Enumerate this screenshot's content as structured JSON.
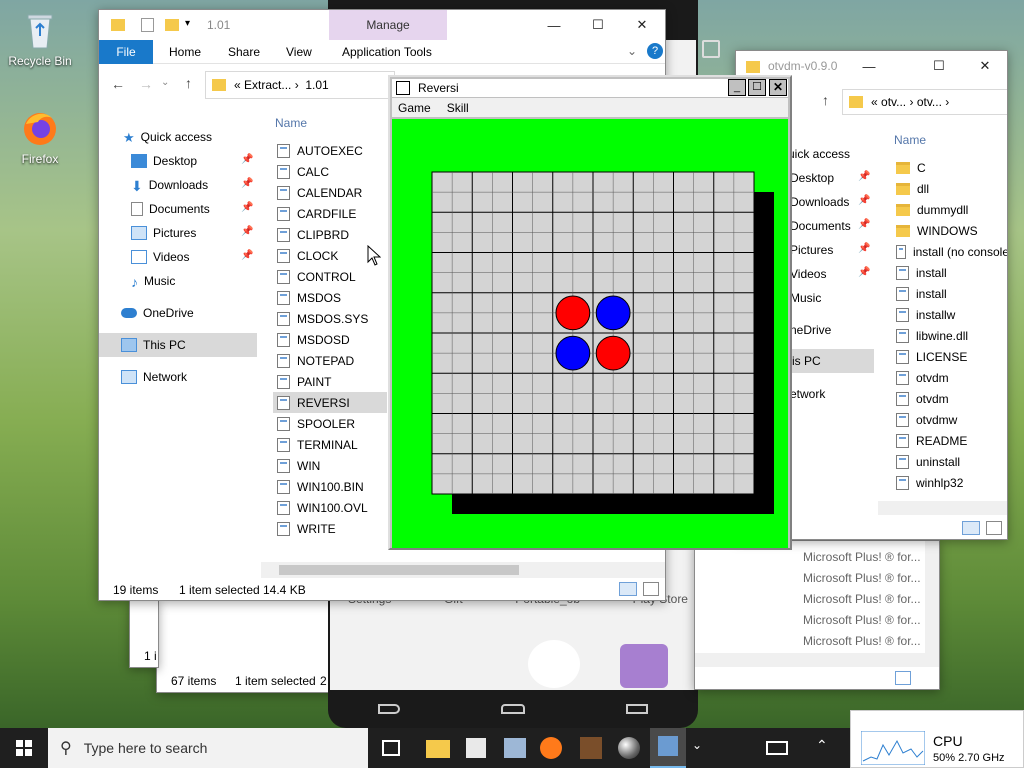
{
  "desktop": {
    "recycle_bin": "Recycle Bin",
    "firefox": "Firefox"
  },
  "explorer_back": {
    "status_items": "67 items",
    "status_selected": "1 item selected",
    "status_cut": "2"
  },
  "phone": {
    "labels": [
      "Settings",
      "Gift",
      "Portable_ob",
      "Play Store"
    ]
  },
  "otvdm": {
    "title": "otvdm-v0.9.0",
    "breadcrumb": [
      "otv...",
      "otv..."
    ],
    "column_name": "Name",
    "nav": [
      "uick access",
      "Desktop",
      "Downloads",
      "Documents",
      "Pictures",
      "Videos",
      "Music",
      "neDrive",
      "is PC",
      "etwork"
    ],
    "files": [
      {
        "name": "C",
        "kind": "folder"
      },
      {
        "name": "dll",
        "kind": "folder"
      },
      {
        "name": "dummydll",
        "kind": "folder"
      },
      {
        "name": "WINDOWS",
        "kind": "folder"
      },
      {
        "name": "install (no console",
        "kind": "file"
      },
      {
        "name": "install",
        "kind": "file"
      },
      {
        "name": "install",
        "kind": "file"
      },
      {
        "name": "installw",
        "kind": "file"
      },
      {
        "name": "libwine.dll",
        "kind": "file"
      },
      {
        "name": "LICENSE",
        "kind": "file"
      },
      {
        "name": "otvdm",
        "kind": "file"
      },
      {
        "name": "otvdm",
        "kind": "file"
      },
      {
        "name": "otvdmw",
        "kind": "file"
      },
      {
        "name": "README",
        "kind": "file"
      },
      {
        "name": "uninstall",
        "kind": "file"
      },
      {
        "name": "winhlp32",
        "kind": "file"
      }
    ]
  },
  "midlist": {
    "rows": [
      "Microsoft Plus! ® for...",
      "Microsoft Plus! ® for...",
      "Microsoft Plus! ® for...",
      "Microsoft Plus! ® for...",
      "Microsoft Plus! ® for..."
    ]
  },
  "explorer": {
    "title": "1.01",
    "manage_tab": "Manage",
    "tabs": [
      "File",
      "Home",
      "Share",
      "View",
      "Application Tools"
    ],
    "breadcrumb": [
      "Extract...",
      "1.01"
    ],
    "quick_access": "Quick access",
    "nav": [
      "Desktop",
      "Downloads",
      "Documents",
      "Pictures",
      "Videos",
      "Music"
    ],
    "onedrive": "OneDrive",
    "this_pc": "This PC",
    "network": "Network",
    "column_name": "Name",
    "files": [
      "AUTOEXEC",
      "CALC",
      "CALENDAR",
      "CARDFILE",
      "CLIPBRD",
      "CLOCK",
      "CONTROL",
      "MSDOS",
      "MSDOS.SYS",
      "MSDOSD",
      "NOTEPAD",
      "PAINT",
      "REVERSI",
      "SPOOLER",
      "TERMINAL",
      "WIN",
      "WIN100.BIN",
      "WIN100.OVL",
      "WRITE"
    ],
    "selected_file": "REVERSI",
    "status_items": "19 items",
    "status_selected": "1 item selected",
    "status_size": "14.4 KB"
  },
  "reversi": {
    "title": "Reversi",
    "menu": [
      "Game",
      "Skill"
    ],
    "board_size": 8,
    "pieces": [
      {
        "row": 3,
        "col": 3,
        "color": "red"
      },
      {
        "row": 3,
        "col": 4,
        "color": "blue"
      },
      {
        "row": 4,
        "col": 3,
        "color": "blue"
      },
      {
        "row": 4,
        "col": 4,
        "color": "red"
      }
    ],
    "colors": {
      "background": "#00ff00",
      "red": "#ff0000",
      "blue": "#0000ff"
    }
  },
  "taskbar": {
    "search_placeholder": "Type here to search",
    "cpu_label": "CPU",
    "cpu_value": "50%  2.70 GHz"
  }
}
